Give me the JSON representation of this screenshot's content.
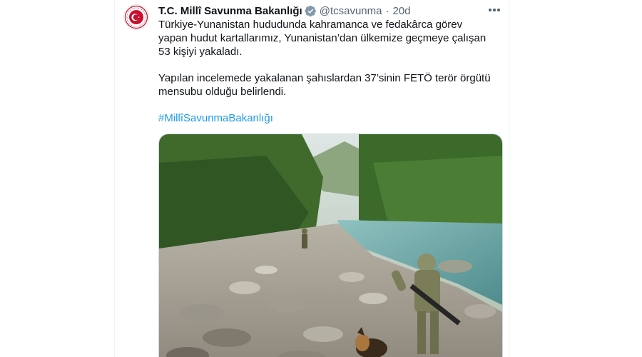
{
  "tweet": {
    "author_name": "T.C. Millî Savunma Bakanlığı",
    "handle": "@tcsavunma",
    "separator": "·",
    "time": "20d",
    "paragraph1": "Türkiye-Yunanistan hududunda kahramanca ve fedakârca görev yapan hudut kartallarımız, Yunanistan’dan ülkemize geçmeye çalışan 53 kişiyi yakaladı.",
    "paragraph2": "Yapılan incelemede yakalanan şahıslardan 37’sinin FETÖ terör örgütü mensubu olduğu belirlendi.",
    "hashtag": "#MillîSavunmaBakanlığı"
  },
  "icons": {
    "verified": "verified-badge-icon",
    "more": "more-options-icon",
    "avatar": "ministry-emblem-icon"
  },
  "colors": {
    "text": "#0f1419",
    "secondary": "#536471",
    "link": "#1d9bf0",
    "verified_badge": "#829aab",
    "emblem_red": "#c8102e"
  }
}
